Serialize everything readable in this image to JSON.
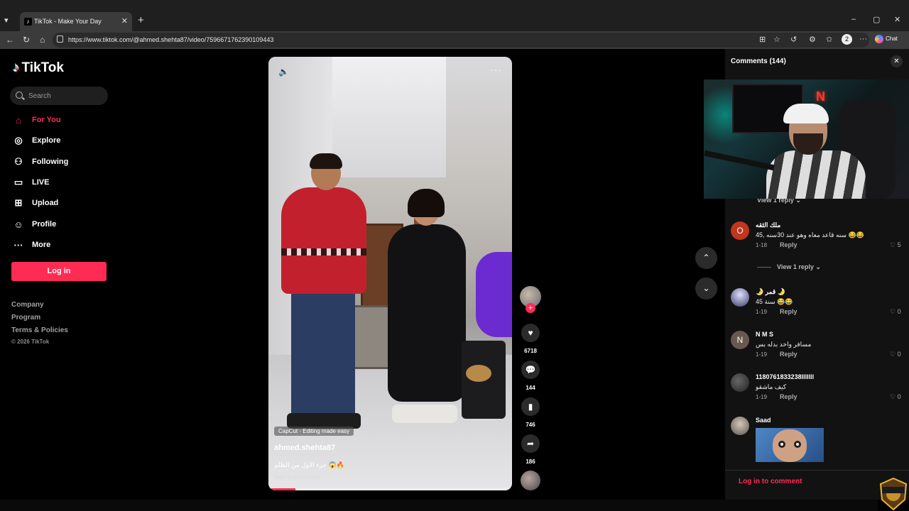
{
  "browser": {
    "tab_title": "TikTok - Make Your Day",
    "tab_close": "✕",
    "new_tab": "+",
    "url": "https://www.tiktok.com/@ahmed.shehta87/video/7596671762390109443",
    "profile_initial": "2",
    "chat_label": "Chat",
    "window_controls": [
      "–",
      "▢",
      "✕"
    ]
  },
  "sidebar": {
    "logo": "TikTok",
    "search_placeholder": "Search",
    "nav": [
      {
        "label": "For You",
        "icon": "home-icon",
        "active": true
      },
      {
        "label": "Explore",
        "icon": "compass-icon"
      },
      {
        "label": "Following",
        "icon": "following-icon"
      },
      {
        "label": "LIVE",
        "icon": "live-icon"
      },
      {
        "label": "Upload",
        "icon": "upload-icon"
      },
      {
        "label": "Profile",
        "icon": "profile-icon"
      },
      {
        "label": "More",
        "icon": "more-icon"
      }
    ],
    "login": "Log in",
    "footer": [
      "Company",
      "Program",
      "Terms & Policies"
    ],
    "copyright": "© 2026 TikTok"
  },
  "video": {
    "capcut": "CapCut · Editing made easy",
    "author": "ahmed.shehta87",
    "caption": "جزء الاول من الظلم 😱🔥",
    "translate": "See translation",
    "progress": 0.11
  },
  "actions": {
    "likes": "6718",
    "comments": "144",
    "saves": "746",
    "shares": "186"
  },
  "comments_panel": {
    "title": "Comments",
    "count": "(144)",
    "items": [
      {
        "view_reply": "View 1 reply"
      },
      {
        "avatar": "O",
        "avatar_color": "#c0361e",
        "user": "ملك الثقه",
        "text": "45, سنه قاعد معاه وهو عند 30سنه 😂😂",
        "date": "1-18",
        "reply": "Reply",
        "likes": "5"
      },
      {
        "view_reply": "View 1 reply"
      },
      {
        "avatar": "",
        "avatar_color": "#3a3b6b",
        "user": "🌛 قمر 🌛",
        "text": "45 سنة 😂😂",
        "date": "1-19",
        "reply": "Reply",
        "likes": "0"
      },
      {
        "avatar": "N",
        "avatar_color": "#6a5750",
        "user": "N M S",
        "text": "مسافر واخد بدله بس",
        "date": "1-19",
        "reply": "Reply",
        "likes": "0"
      },
      {
        "avatar": "",
        "avatar_color": "#3a3a3a",
        "user": "1180761833238lllllll",
        "text": "كيف ماشقو",
        "date": "1-19",
        "reply": "Reply",
        "likes": "0"
      },
      {
        "avatar": "",
        "avatar_color": "#777",
        "user": "Saad"
      }
    ],
    "login_to_comment": "Log in to comment"
  },
  "overlay": {
    "neon": "N"
  }
}
